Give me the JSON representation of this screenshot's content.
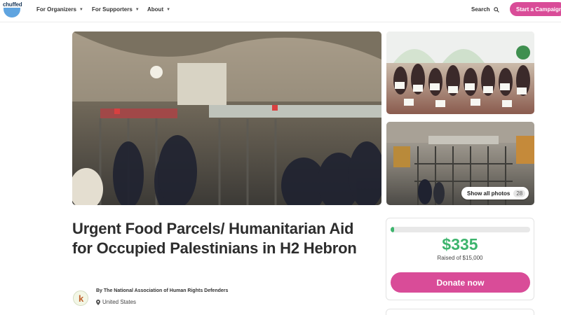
{
  "header": {
    "logo_text": "chuffed",
    "nav": [
      {
        "label": "For Organizers"
      },
      {
        "label": "For Supporters"
      },
      {
        "label": "About"
      }
    ],
    "search_label": "Search",
    "cta_label": "Start a Campaign"
  },
  "gallery": {
    "show_all_label": "Show all photos",
    "photo_count": "28"
  },
  "campaign": {
    "title": "Urgent Food Parcels/ Humanitarian Aid for Occupied Palestinians in H2 Hebron",
    "organizer_prefix": "By",
    "organizer": "The National Association of Human Rights Defenders",
    "location": "United States"
  },
  "donation": {
    "raised": "$335",
    "goal_text": "Raised of $15,000",
    "progress_fraction": 0.022,
    "donate_label": "Donate now"
  },
  "colors": {
    "brand_pink": "#d94c98",
    "success_green": "#3db46d",
    "logo_blue": "#5fa4e0"
  }
}
